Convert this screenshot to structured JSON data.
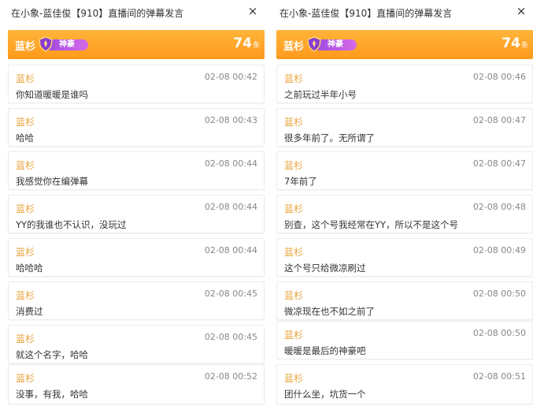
{
  "panels": [
    {
      "title": "在小象-蓝佳俊【910】直播间的弹幕发言",
      "close_icon": "×",
      "header": {
        "name": "蓝杉",
        "badge": "神豪",
        "count": "74",
        "unit": "条"
      },
      "messages": [
        {
          "user": "蓝杉",
          "time": "02-08 00:42",
          "text": "你知道暖暖是谁吗"
        },
        {
          "user": "蓝杉",
          "time": "02-08 00:43",
          "text": "哈哈"
        },
        {
          "user": "蓝杉",
          "time": "02-08 00:44",
          "text": "我感觉你在编弹幕"
        },
        {
          "user": "蓝杉",
          "time": "02-08 00:44",
          "text": "YY的我谁也不认识，没玩过"
        },
        {
          "user": "蓝杉",
          "time": "02-08 00:44",
          "text": "哈哈哈"
        },
        {
          "user": "蓝杉",
          "time": "02-08 00:45",
          "text": "消费过"
        },
        {
          "user": "蓝杉",
          "time": "02-08 00:45",
          "text": "就这个名字，哈哈"
        },
        {
          "user": "蓝杉",
          "time": "02-08 00:52",
          "text": "没事，有我，哈哈"
        }
      ]
    },
    {
      "title": "在小象-蓝佳俊【910】直播间的弹幕发言",
      "close_icon": "×",
      "header": {
        "name": "蓝杉",
        "badge": "神豪",
        "count": "74",
        "unit": "条"
      },
      "messages": [
        {
          "user": "蓝杉",
          "time": "02-08 00:46",
          "text": "之前玩过半年小号"
        },
        {
          "user": "蓝杉",
          "time": "02-08 00:47",
          "text": "很多年前了。无所谓了"
        },
        {
          "user": "蓝杉",
          "time": "02-08 00:47",
          "text": "7年前了"
        },
        {
          "user": "蓝杉",
          "time": "02-08 00:48",
          "text": "别查，这个号我经常在YY，所以不是这个号"
        },
        {
          "user": "蓝杉",
          "time": "02-08 00:49",
          "text": "这个号只给微凉刷过"
        },
        {
          "user": "蓝杉",
          "time": "02-08 00:50",
          "text": "微凉现在也不如之前了"
        },
        {
          "user": "蓝杉",
          "time": "02-08 00:50",
          "text": "暖暖是最后的神豪吧"
        },
        {
          "user": "蓝杉",
          "time": "02-08 00:51",
          "text": "团什么坐，坑货一个"
        }
      ]
    }
  ]
}
